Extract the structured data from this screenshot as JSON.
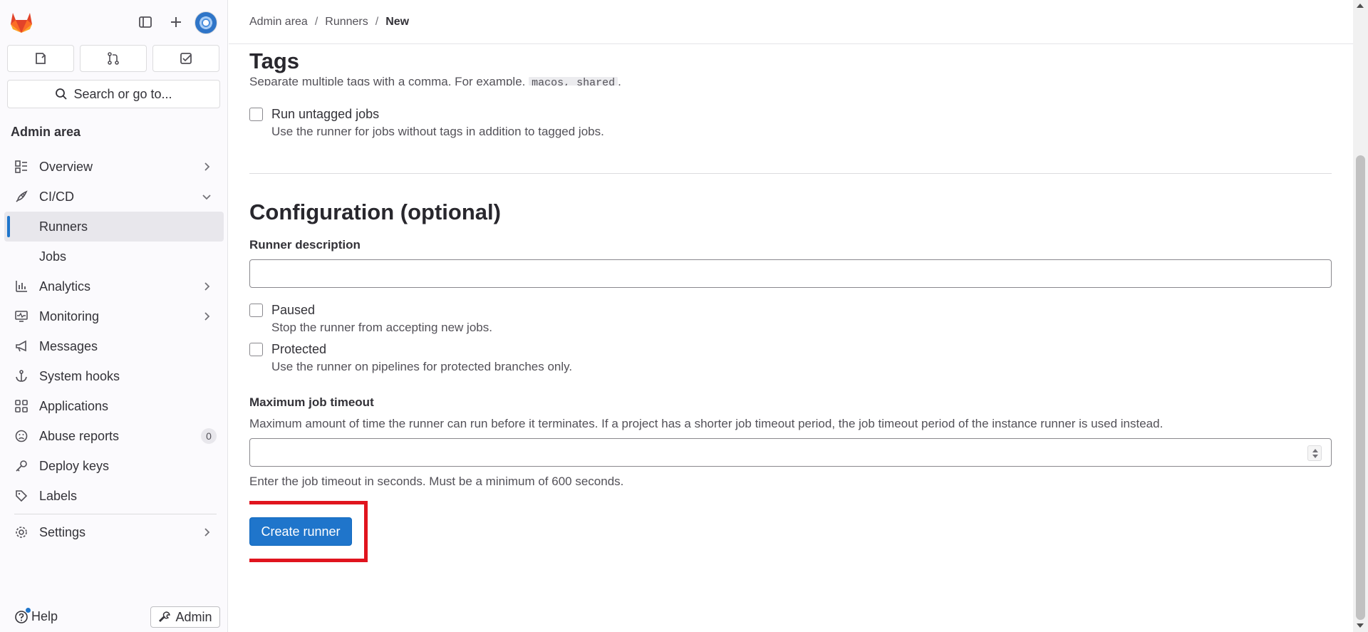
{
  "sidebar": {
    "search_label": "Search or go to...",
    "section_title": "Admin area",
    "items": [
      {
        "label": "Overview"
      },
      {
        "label": "CI/CD"
      },
      {
        "label": "Runners"
      },
      {
        "label": "Jobs"
      },
      {
        "label": "Analytics"
      },
      {
        "label": "Monitoring"
      },
      {
        "label": "Messages"
      },
      {
        "label": "System hooks"
      },
      {
        "label": "Applications"
      },
      {
        "label": "Abuse reports",
        "badge": "0"
      },
      {
        "label": "Deploy keys"
      },
      {
        "label": "Labels"
      },
      {
        "label": "Settings"
      }
    ],
    "help_label": "Help",
    "admin_label": "Admin"
  },
  "breadcrumb": {
    "items": [
      "Admin area",
      "Runners",
      "New"
    ],
    "separator": "/"
  },
  "tags_section": {
    "heading": "Tags",
    "help_text_before": "Separate multiple tags with a comma. For example, ",
    "help_code": "macos, shared",
    "help_text_after": ".",
    "run_untagged_label": "Run untagged jobs",
    "run_untagged_help": "Use the runner for jobs without tags in addition to tagged jobs."
  },
  "config_section": {
    "heading": "Configuration (optional)",
    "description_label": "Runner description",
    "description_value": "",
    "paused_label": "Paused",
    "paused_help": "Stop the runner from accepting new jobs.",
    "protected_label": "Protected",
    "protected_help": "Use the runner on pipelines for protected branches only.",
    "timeout_label": "Maximum job timeout",
    "timeout_desc": "Maximum amount of time the runner can run before it terminates. If a project has a shorter job timeout period, the job timeout period of the instance runner is used instead.",
    "timeout_value": "",
    "timeout_hint": "Enter the job timeout in seconds. Must be a minimum of 600 seconds."
  },
  "actions": {
    "create_label": "Create runner"
  },
  "colors": {
    "primary": "#1f75cb",
    "highlight": "#e0141e"
  }
}
